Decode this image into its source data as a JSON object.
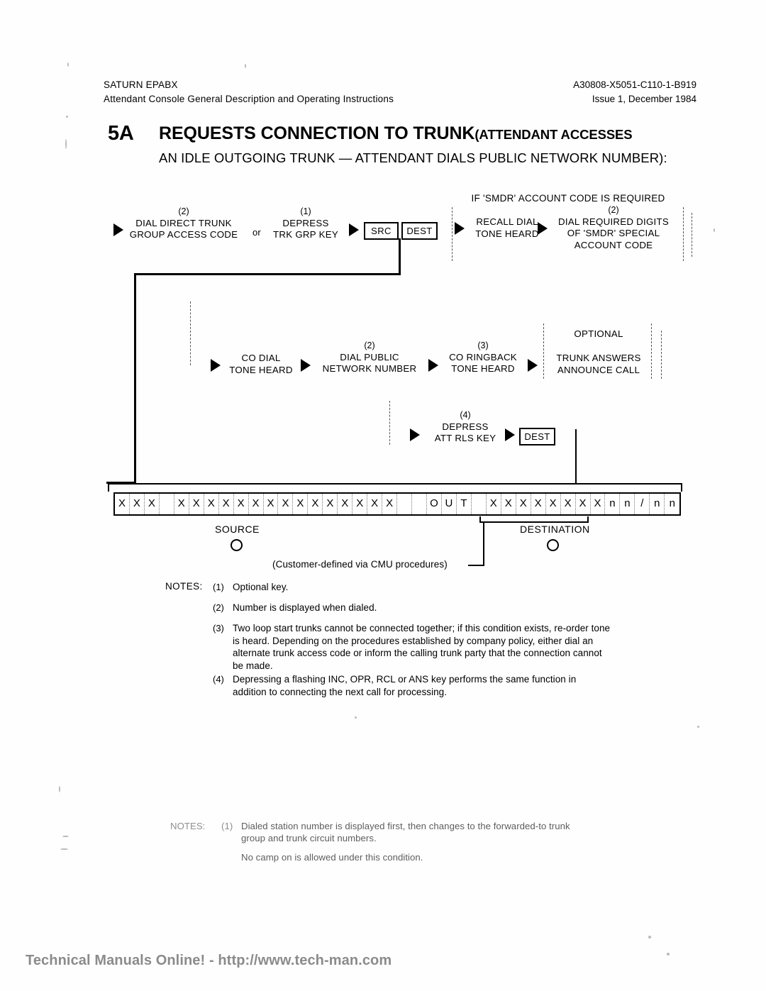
{
  "header": {
    "left_line1": "SATURN EPABX",
    "left_line2": "Attendant Console General Description and Operating Instructions",
    "right_line1": "A30808-X5051-C110-1-B919",
    "right_line2": "Issue 1, December 1984"
  },
  "title": {
    "number": "5A",
    "main": "REQUESTS CONNECTION TO TRUNK",
    "main_paren": "(ATTENDANT ACCESSES",
    "subtitle": "AN IDLE OUTGOING TRUNK — ATTENDANT DIALS PUBLIC NETWORK NUMBER):"
  },
  "flow": {
    "smdr_header": "IF 'SMDR' ACCOUNT CODE IS REQUIRED",
    "optional_header": "OPTIONAL",
    "or_connector": "or",
    "step_dial_trunk": {
      "note": "(2)",
      "line1": "DIAL DIRECT TRUNK",
      "line2": "GROUP ACCESS CODE"
    },
    "step_depress_trk": {
      "note": "(1)",
      "line1": "DEPRESS",
      "line2": "TRK GRP KEY"
    },
    "key_src": "SRC",
    "key_dest": "DEST",
    "step_recall": {
      "note": "",
      "line1": "RECALL DIAL",
      "line2": "TONE HEARD"
    },
    "step_smdr_digits": {
      "note": "(2)",
      "line1": "DIAL REQUIRED DIGITS",
      "line2": "OF 'SMDR' SPECIAL",
      "line3": "ACCOUNT CODE"
    },
    "step_co_dial": {
      "note": "",
      "line1": "CO DIAL",
      "line2": "TONE HEARD"
    },
    "step_dial_public": {
      "note": "(2)",
      "line1": "DIAL PUBLIC",
      "line2": "NETWORK NUMBER"
    },
    "step_co_ringback": {
      "note": "(3)",
      "line1": "CO RINGBACK",
      "line2": "TONE HEARD"
    },
    "step_trunk_answers": {
      "note": "",
      "line1": "TRUNK ANSWERS",
      "line2": "ANNOUNCE CALL"
    },
    "step_att_rls": {
      "note": "(4)",
      "line1": "DEPRESS",
      "line2": "ATT RLS KEY"
    },
    "key_dest2": "DEST"
  },
  "display": {
    "groups": [
      {
        "id": "src-group-1",
        "chars": [
          "X",
          "X",
          "X",
          ""
        ]
      },
      {
        "id": "src-group-2",
        "chars": [
          "X",
          "X",
          "X",
          "X",
          "X",
          "X",
          "X",
          "X"
        ]
      },
      {
        "id": "src-group-3",
        "chars": [
          "X",
          "X",
          "X",
          "X",
          "X",
          "X",
          "X",
          ""
        ]
      },
      {
        "id": "spacer-1",
        "chars": [
          ""
        ]
      },
      {
        "id": "dest-out",
        "chars": [
          "O",
          "U",
          "T",
          ""
        ]
      },
      {
        "id": "dest-digits",
        "chars": [
          "X",
          "X",
          "X",
          "X",
          "X",
          "X",
          "X",
          "X"
        ]
      },
      {
        "id": "dest-circuit",
        "chars": [
          "n",
          "n",
          "/",
          "n",
          "n"
        ]
      }
    ],
    "source_label": "SOURCE",
    "destination_label": "DESTINATION",
    "cmu_caption": "(Customer-defined via CMU procedures)"
  },
  "notes": {
    "label": "NOTES:",
    "items": [
      {
        "num": "(1)",
        "text": "Optional key."
      },
      {
        "num": "(2)",
        "text": "Number is displayed when dialed."
      },
      {
        "num": "(3)",
        "text": "Two loop start trunks cannot be connected together; if this condition exists, re-order tone is heard. Depending on the procedures established by company policy, either dial an alternate trunk access code or inform the calling trunk party that the connection cannot be made."
      },
      {
        "num": "(4)",
        "text": "Depressing a flashing INC, OPR, RCL or ANS key performs the same function in addition to connecting the next call for processing."
      }
    ]
  },
  "ghost_notes": {
    "label": "NOTES:",
    "num": "(1)",
    "line1": "Dialed station number is displayed first, then changes to the forwarded-to trunk",
    "line2": "group and trunk circuit numbers.",
    "line3": "No camp on is allowed under this condition."
  },
  "footer": {
    "text": "Technical Manuals Online! - http://www.tech-man.com"
  }
}
